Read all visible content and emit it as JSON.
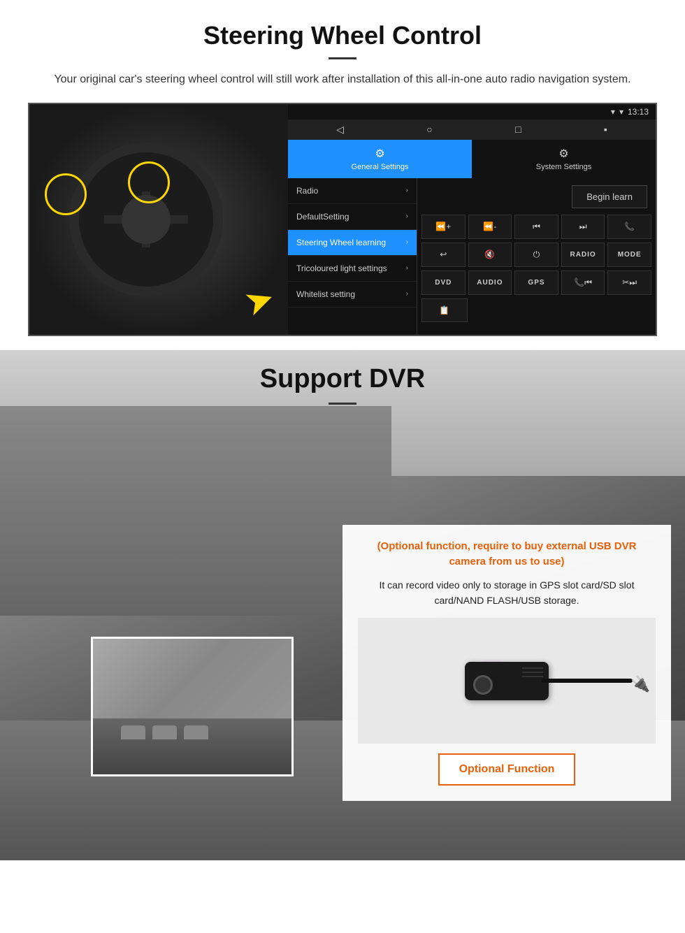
{
  "steering_section": {
    "title": "Steering Wheel Control",
    "subtitle": "Your original car's steering wheel control will still work after installation of this all-in-one auto radio navigation system.",
    "status_bar": {
      "time": "13:13",
      "signal_icon": "▾",
      "wifi_icon": "▾",
      "battery_icon": "▮"
    },
    "nav_bar": {
      "back": "◁",
      "home": "○",
      "recent": "□",
      "menu": "▪"
    },
    "tabs": [
      {
        "label": "General Settings",
        "icon": "⚙",
        "active": true
      },
      {
        "label": "System Settings",
        "icon": "🔧",
        "active": false
      }
    ],
    "menu_items": [
      {
        "label": "Radio",
        "active": false
      },
      {
        "label": "DefaultSetting",
        "active": false
      },
      {
        "label": "Steering Wheel learning",
        "active": true
      },
      {
        "label": "Tricoloured light settings",
        "active": false
      },
      {
        "label": "Whitelist setting",
        "active": false
      }
    ],
    "begin_learn_label": "Begin learn",
    "control_buttons": [
      {
        "label": "▐+",
        "row": 1
      },
      {
        "label": "▐-",
        "row": 1
      },
      {
        "label": "⏮",
        "row": 1
      },
      {
        "label": "⏭",
        "row": 1
      },
      {
        "label": "📞",
        "row": 1
      },
      {
        "label": "↩",
        "row": 2
      },
      {
        "label": "🔇",
        "row": 2
      },
      {
        "label": "⏻",
        "row": 2
      },
      {
        "label": "RADIO",
        "row": 2,
        "text": true
      },
      {
        "label": "MODE",
        "row": 2,
        "text": true
      },
      {
        "label": "DVD",
        "row": 3,
        "text": true
      },
      {
        "label": "AUDIO",
        "row": 3,
        "text": true
      },
      {
        "label": "GPS",
        "row": 3,
        "text": true
      },
      {
        "label": "📞⏮",
        "row": 3
      },
      {
        "label": "✂⏭",
        "row": 3
      },
      {
        "label": "📋",
        "row": 4
      }
    ]
  },
  "dvr_section": {
    "title": "Support DVR",
    "optional_text": "(Optional function, require to buy external USB DVR camera from us to use)",
    "description": "It can record video only to storage in GPS slot card/SD slot card/NAND FLASH/USB storage.",
    "optional_button_label": "Optional Function"
  }
}
